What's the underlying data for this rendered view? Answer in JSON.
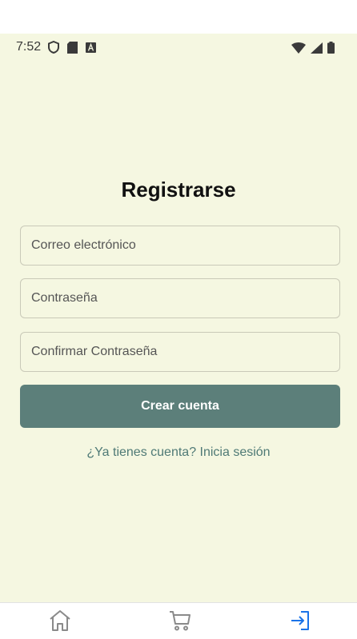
{
  "status_bar": {
    "time": "7:52",
    "left_icons": [
      "shield-icon",
      "sd-card-icon",
      "font-icon"
    ],
    "right_icons": [
      "wifi-icon",
      "cell-signal-icon",
      "battery-icon"
    ]
  },
  "register": {
    "title": "Registrarse",
    "email_placeholder": "Correo electrónico",
    "password_placeholder": "Contraseña",
    "confirm_placeholder": "Confirmar Contraseña",
    "create_button": "Crear cuenta",
    "login_link": "¿Ya tienes cuenta? Inicia sesión"
  },
  "bottom_nav": {
    "items": [
      {
        "icon": "home-icon",
        "active": false
      },
      {
        "icon": "cart-icon",
        "active": false
      },
      {
        "icon": "login-icon",
        "active": true
      }
    ]
  },
  "colors": {
    "background": "#f5f7e1",
    "button": "#5c7f7a",
    "link": "#4f7a76",
    "nav_active": "#1a73e8",
    "nav_inactive": "#8a8a8a"
  }
}
